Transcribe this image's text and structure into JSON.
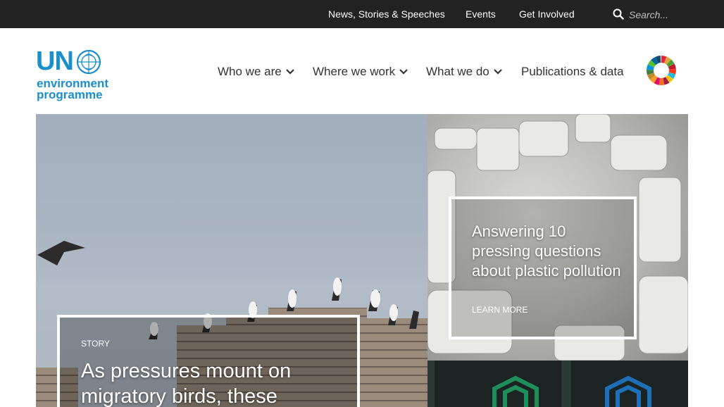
{
  "topnav": {
    "links": [
      "News, Stories & Speeches",
      "Events",
      "Get Involved"
    ],
    "search_placeholder": "Search..."
  },
  "logo": {
    "un": "UN",
    "line1": "environment",
    "line2": "programme"
  },
  "mainnav": {
    "items": [
      "Who we are",
      "Where we work",
      "What we do",
      "Publications & data"
    ]
  },
  "hero": {
    "kicker": "STORY",
    "title": "As pressures mount on migratory birds, these"
  },
  "feature": {
    "title": "Answering 10 pressing questions about plastic pollution",
    "cta": "LEARN MORE"
  },
  "colors": {
    "topbar": "#222222",
    "brand_blue": "#1a8fcc",
    "nav_text": "#333333"
  }
}
